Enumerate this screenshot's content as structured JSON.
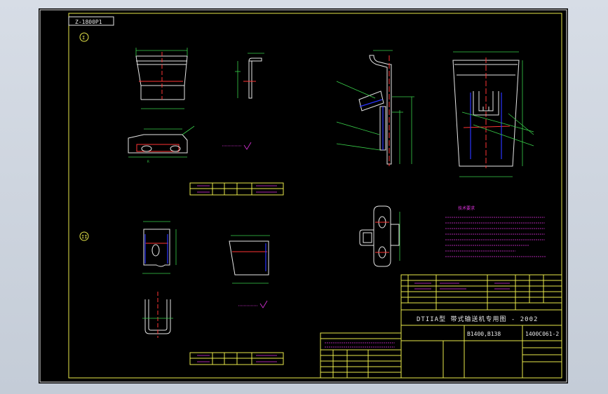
{
  "drawing_number_box": "Z-1800P1",
  "view_markers": [
    "I",
    "II"
  ],
  "notes_title": "技术要求",
  "main_title": "DTIIA型 带式输送机专用图 - 2002",
  "drawing_code": "B1400,B138",
  "part_code": "1400C061-2",
  "part_name": "",
  "colors": {
    "yellow": "#e8e84a",
    "white": "#e6e6e6",
    "green": "#39d04a",
    "red": "#ff3333",
    "magenta": "#e033e0",
    "blue": "#2a34ff"
  }
}
